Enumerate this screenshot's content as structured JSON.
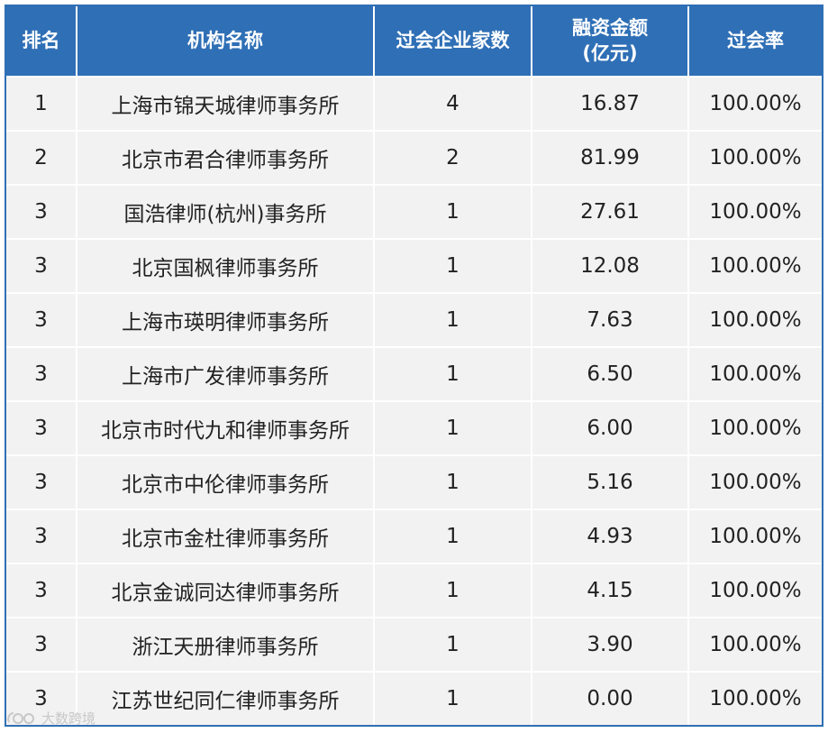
{
  "table": {
    "headers": [
      {
        "line1": "排名",
        "line2": ""
      },
      {
        "line1": "机构名称",
        "line2": ""
      },
      {
        "line1": "过会企业家数",
        "line2": ""
      },
      {
        "line1": "融资金额",
        "line2": "(亿元)"
      },
      {
        "line1": "过会率",
        "line2": ""
      }
    ],
    "rows": [
      [
        "1",
        "上海市锦天城律师事务所",
        "4",
        "16.87",
        "100.00%"
      ],
      [
        "2",
        "北京市君合律师事务所",
        "2",
        "81.99",
        "100.00%"
      ],
      [
        "3",
        "国浩律师(杭州)事务所",
        "1",
        "27.61",
        "100.00%"
      ],
      [
        "3",
        "北京国枫律师事务所",
        "1",
        "12.08",
        "100.00%"
      ],
      [
        "3",
        "上海市瑛明律师事务所",
        "1",
        "7.63",
        "100.00%"
      ],
      [
        "3",
        "上海市广发律师事务所",
        "1",
        "6.50",
        "100.00%"
      ],
      [
        "3",
        "北京市时代九和律师事务所",
        "1",
        "6.00",
        "100.00%"
      ],
      [
        "3",
        "北京市中伦律师事务所",
        "1",
        "5.16",
        "100.00%"
      ],
      [
        "3",
        "北京市金杜律师事务所",
        "1",
        "4.93",
        "100.00%"
      ],
      [
        "3",
        "北京金诚同达律师事务所",
        "1",
        "4.15",
        "100.00%"
      ],
      [
        "3",
        "浙江天册律师事务所",
        "1",
        "3.90",
        "100.00%"
      ],
      [
        "3",
        "江苏世纪同仁律师事务所",
        "1",
        "0.00",
        "100.00%"
      ]
    ]
  },
  "watermark": {
    "text": "大数跨境",
    "icon": "logo-mark-icon"
  },
  "colors": {
    "header_bg": "#2f6fb6",
    "cell_bg": "#f2f2f2"
  }
}
